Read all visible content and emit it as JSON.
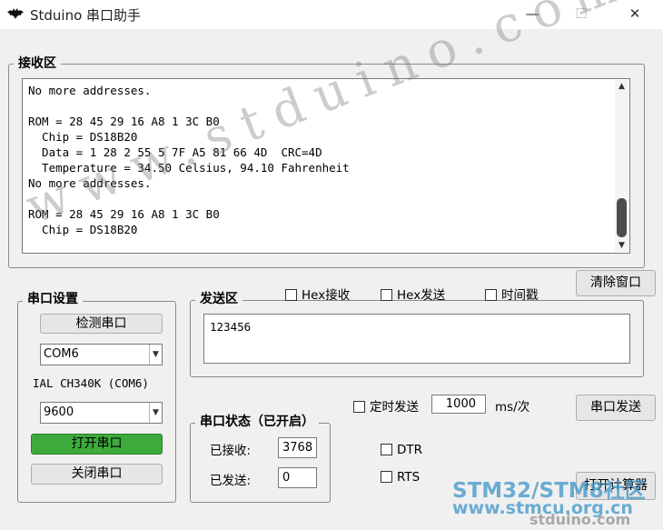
{
  "window": {
    "title": "Stduino 串口助手",
    "minimize_glyph": "—",
    "maximize_glyph": "☐",
    "close_glyph": "✕"
  },
  "receive": {
    "label": "接收区",
    "text": "No more addresses.\n\nROM = 28 45 29 16 A8 1 3C B0\n  Chip = DS18B20\n  Data = 1 28 2 55 5 7F A5 81 66 4D  CRC=4D\n  Temperature = 34.50 Celsius, 94.10 Fahrenheit\nNo more addresses.\n\nROM = 28 45 29 16 A8 1 3C B0\n  Chip = DS18B20"
  },
  "buttons": {
    "clear": "清除窗口",
    "send": "串口发送",
    "calculator": "打开计算器"
  },
  "serial_settings": {
    "label": "串口设置",
    "detect": "检测串口",
    "port": "COM6",
    "port_description": "IAL CH340K (COM6)",
    "baud": "9600",
    "open": "打开串口",
    "close": "关闭串口"
  },
  "send_area": {
    "label": "发送区",
    "value": "123456"
  },
  "options": {
    "hex_receive": "Hex接收",
    "hex_send": "Hex发送",
    "timestamp": "时间戳",
    "timed_send": "定时发送",
    "interval": "1000",
    "interval_unit": "ms/次",
    "dtr": "DTR",
    "rts": "RTS"
  },
  "status": {
    "label": "串口状态（已开启）",
    "received_label": "已接收:",
    "received_count": "3768",
    "sent_label": "已发送:",
    "sent_count": "0"
  },
  "watermarks": {
    "diagonal": "www.stduino.com",
    "stm_line1": "STM32/STM8社区",
    "stm_line2": "www.stmcu.org.cn",
    "stduino": "stduino.com"
  },
  "colors": {
    "open_button": "#3cab3c",
    "background": "#f0f0f0"
  }
}
